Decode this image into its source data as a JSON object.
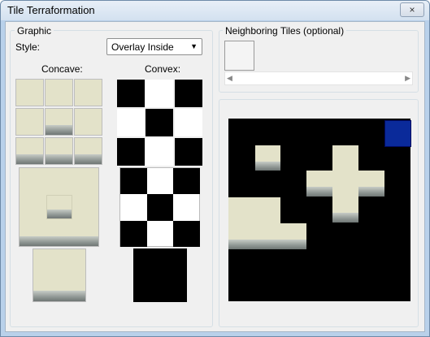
{
  "window": {
    "title": "Tile Terraformation",
    "close_glyph": "×"
  },
  "graphic": {
    "group_label": "Graphic",
    "style_label": "Style:",
    "style_value": "Overlay Inside",
    "concave_label": "Concave:",
    "convex_label": "Convex:"
  },
  "neighboring": {
    "group_label": "Neighboring Tiles (optional)"
  },
  "colors": {
    "tile_fill": "#e3e2c9",
    "rock": "#8f9693",
    "selection": "#0a2a9a",
    "preview_bg": "#000000"
  },
  "icons": {
    "close": "close-icon",
    "dropdown": "chevron-down-icon",
    "scroll_left": "arrow-left-icon",
    "scroll_right": "arrow-right-icon"
  }
}
